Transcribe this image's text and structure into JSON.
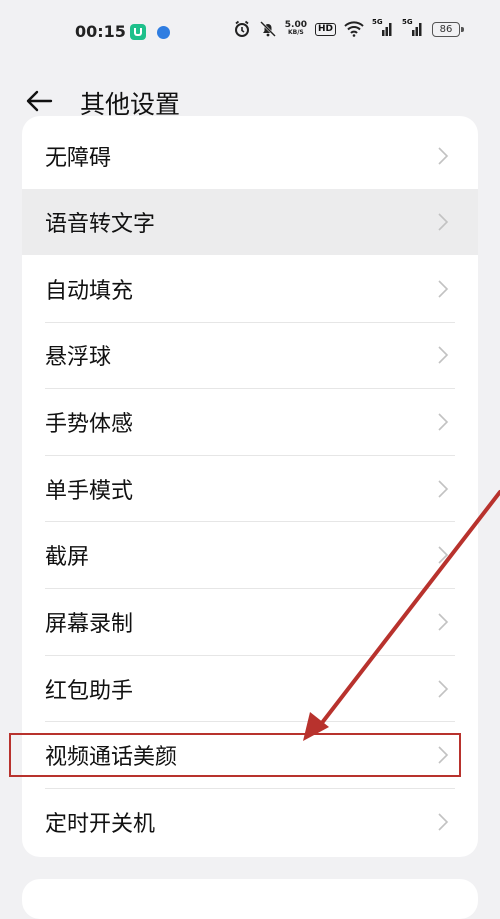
{
  "status_bar": {
    "time": "00:15",
    "net_speed_value": "5.00",
    "net_speed_unit": "KB/S",
    "hd_label": "HD",
    "signal1_label": "5G",
    "signal2_label": "5G",
    "battery": "86",
    "icons": [
      "app-icon-green",
      "app-icon-blue",
      "alarm-icon",
      "mute-icon",
      "wifi-icon",
      "signal-icon",
      "signal-icon",
      "battery-icon"
    ]
  },
  "header": {
    "title": "其他设置",
    "back_icon": "back-arrow-icon"
  },
  "settings": {
    "items": [
      {
        "label": "无障碍"
      },
      {
        "label": "语音转文字"
      },
      {
        "label": "自动填充"
      },
      {
        "label": "悬浮球"
      },
      {
        "label": "手势体感"
      },
      {
        "label": "单手模式"
      },
      {
        "label": "截屏"
      },
      {
        "label": "屏幕录制"
      },
      {
        "label": "红包助手"
      },
      {
        "label": "视频通话美颜"
      },
      {
        "label": "定时开关机"
      }
    ]
  },
  "annotation": {
    "highlight_color": "#b8322d"
  }
}
